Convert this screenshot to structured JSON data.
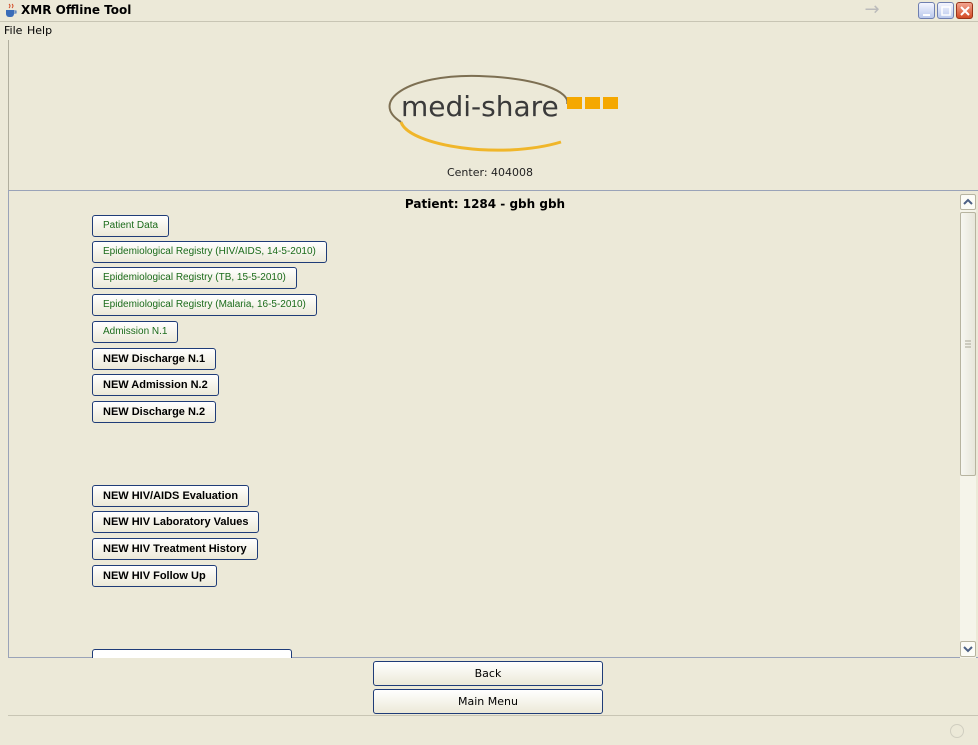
{
  "window": {
    "title": "XMR Offline Tool"
  },
  "menu": {
    "items": [
      "File",
      "Help"
    ]
  },
  "header": {
    "logo_text": "medi-share",
    "center_label": "Center: 404008"
  },
  "main": {
    "patient_title": "Patient: 1284 - gbh gbh",
    "existing_buttons": [
      "Patient Data",
      "Epidemiological Registry  (HIV/AIDS, 14-5-2010)",
      "Epidemiological Registry  (TB, 15-5-2010)",
      "Epidemiological Registry  (Malaria, 16-5-2010)",
      "Admission N.1"
    ],
    "new_buttons_group1": [
      "NEW Discharge N.1",
      "NEW Admission N.2",
      "NEW Discharge N.2"
    ],
    "new_buttons_group2": [
      "NEW HIV/AIDS Evaluation",
      "NEW HIV Laboratory Values",
      "NEW HIV Treatment History",
      "NEW HIV Follow Up"
    ]
  },
  "footer": {
    "back_label": "Back",
    "main_menu_label": "Main Menu"
  },
  "colors": {
    "window_bg": "#ece9d8",
    "existing_text": "#1a6b1a",
    "logo_orange": "#f5a800",
    "button_border": "#1f3c78"
  },
  "icons": {
    "app": "java-cup-icon",
    "arrow": "arrow-right-icon",
    "minimize": "minimize-icon",
    "maximize": "maximize-icon",
    "close": "close-icon"
  }
}
